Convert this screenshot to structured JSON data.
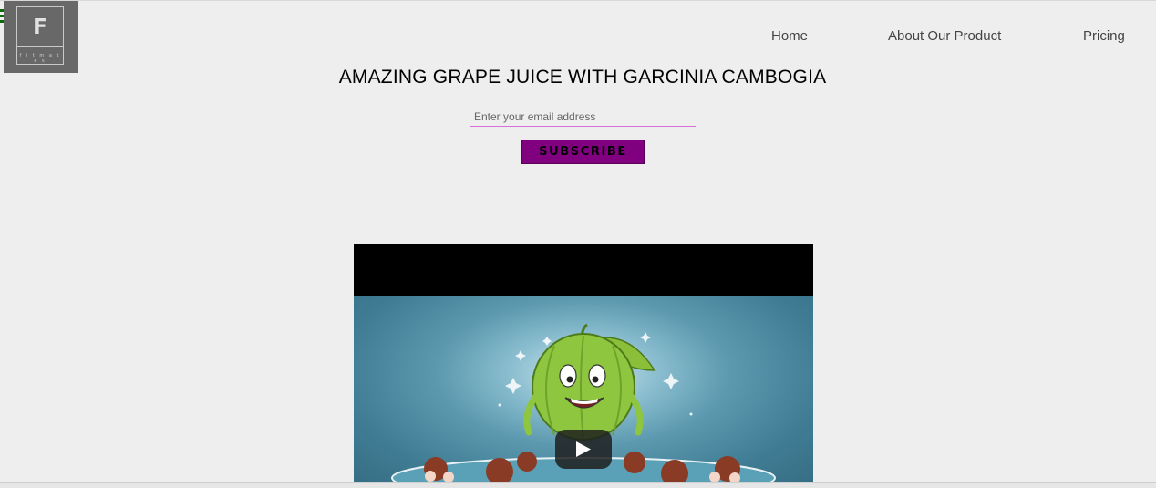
{
  "logo": {
    "letter": "F",
    "subtitle": "f i t m a t e s"
  },
  "nav": {
    "items": [
      {
        "label": "Home"
      },
      {
        "label": "About Our Product"
      },
      {
        "label": "Pricing"
      }
    ]
  },
  "hero": {
    "title": "AMAZING GRAPE JUICE WITH GARCINIA CAMBOGIA"
  },
  "subscribe_form": {
    "email_placeholder": "Enter your email address",
    "email_value": "",
    "button_label": "SUBSCRIBE"
  },
  "video": {
    "play_icon": "play-icon"
  },
  "colors": {
    "background": "#eeeeee",
    "accent": "#800080",
    "input_underline": "#d86fd8",
    "menu_icon": "#0b6b0b"
  }
}
